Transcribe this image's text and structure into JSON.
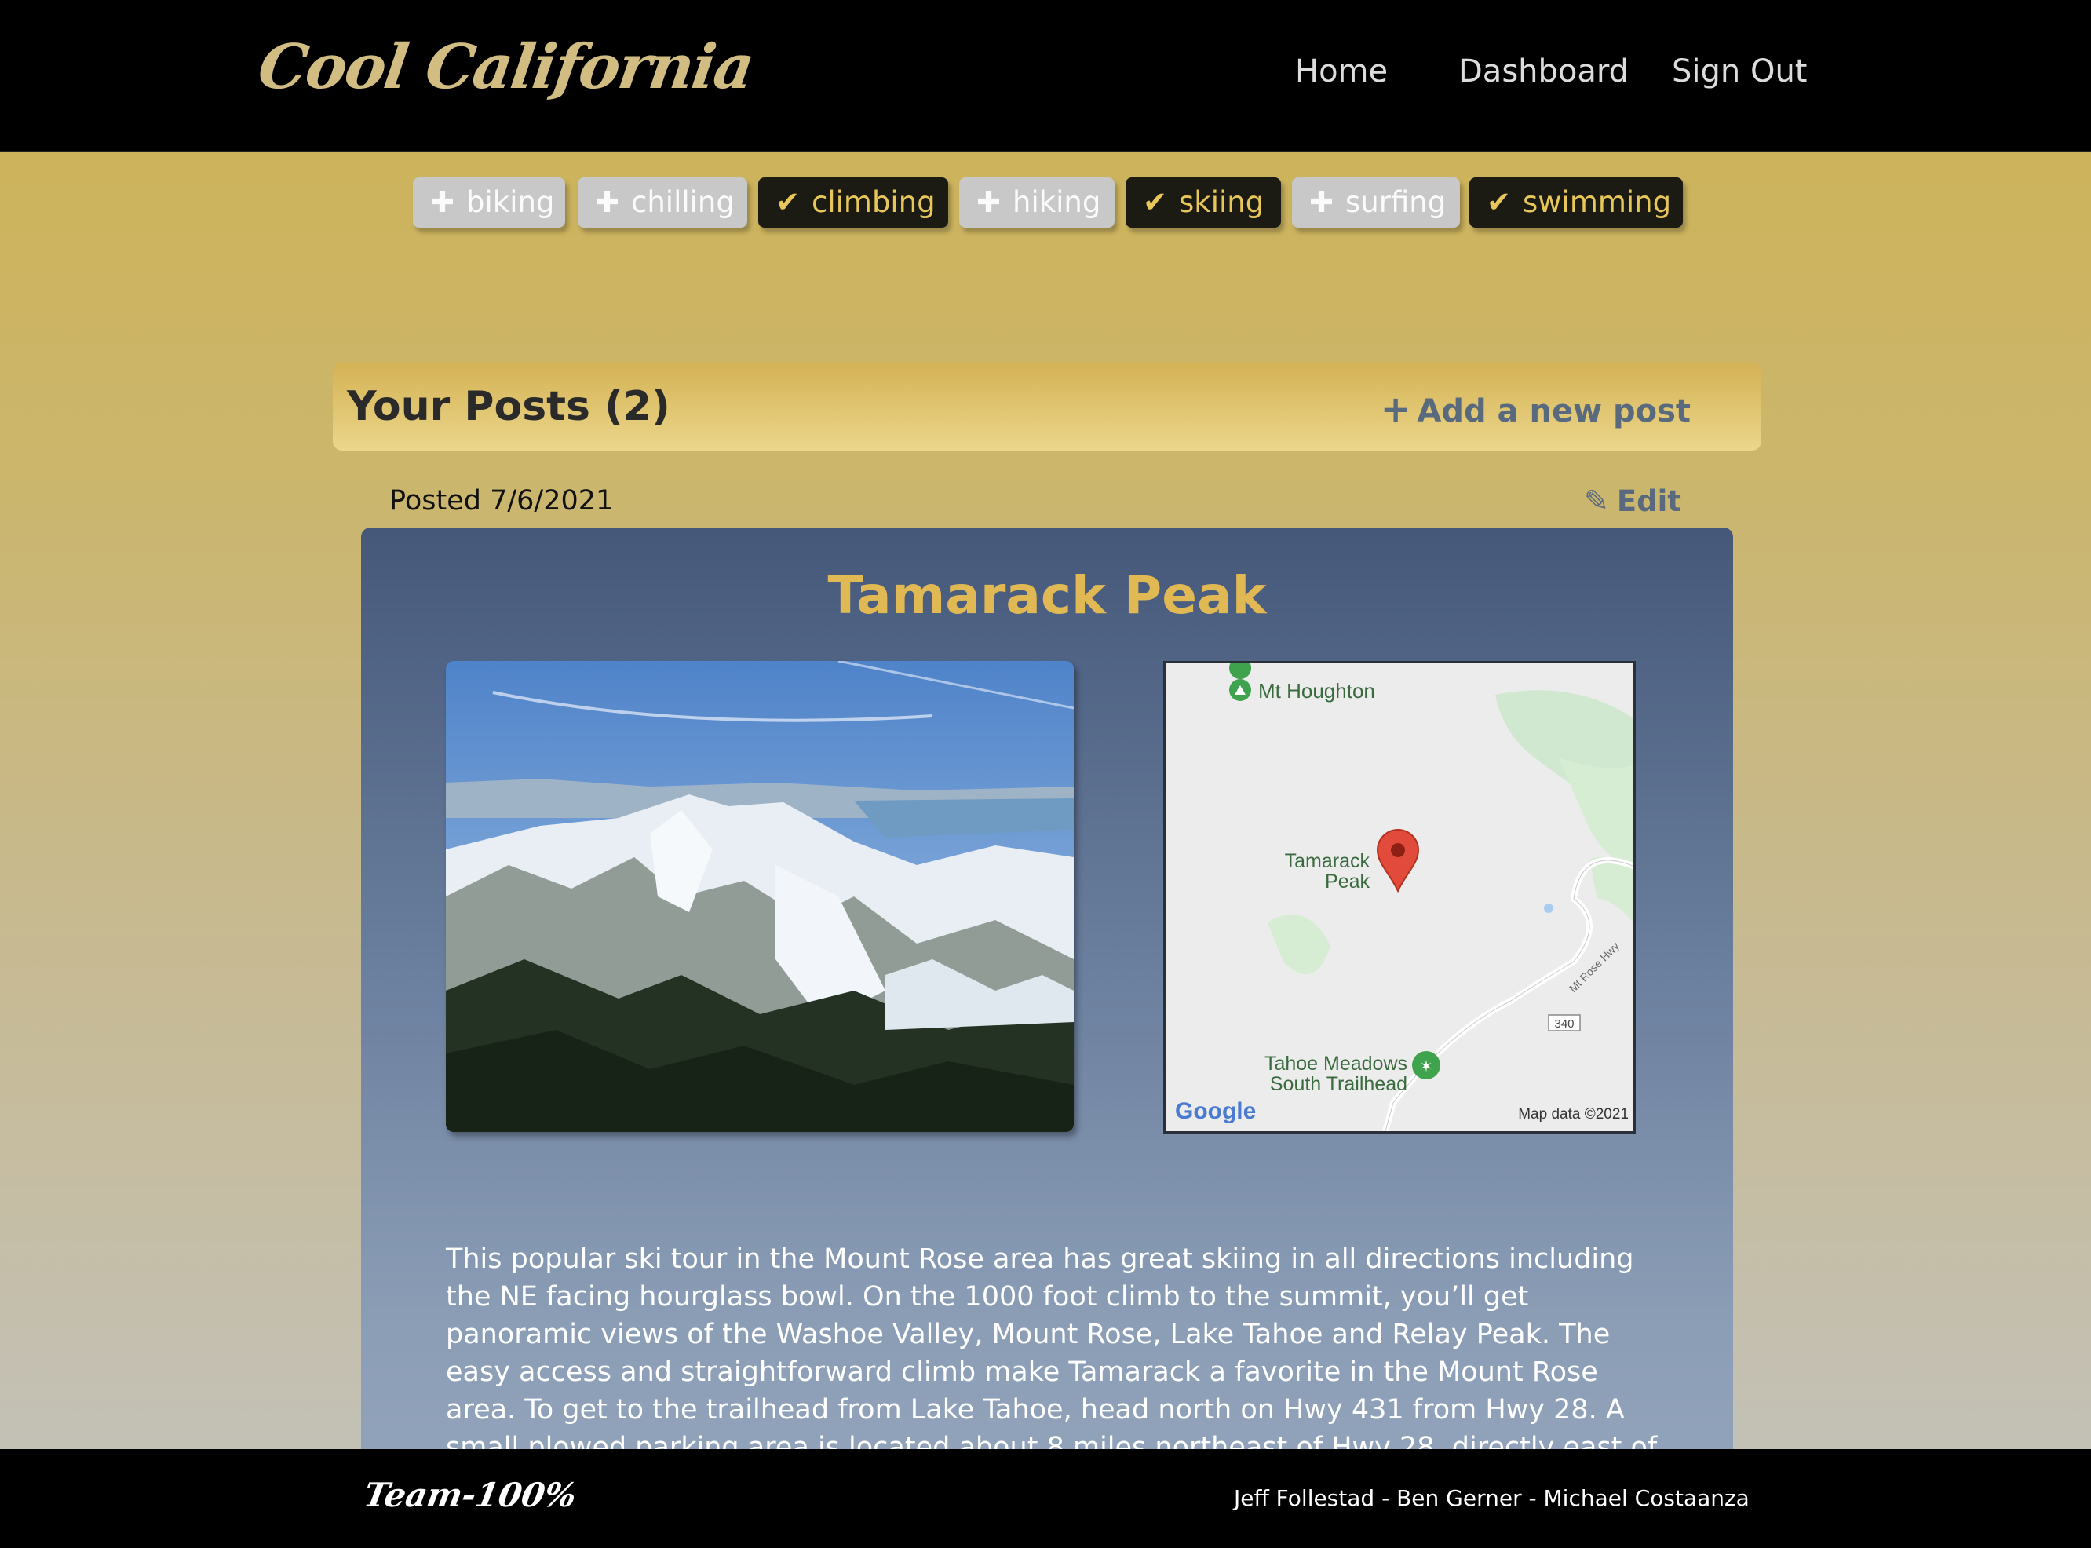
{
  "brand": "Cool California",
  "nav": {
    "home": "Home",
    "dashboard": "Dashboard",
    "sign_out": "Sign Out"
  },
  "filters": [
    {
      "label": "biking",
      "selected": false,
      "icon": "plus-icon"
    },
    {
      "label": "chilling",
      "selected": false,
      "icon": "plus-icon"
    },
    {
      "label": "climbing",
      "selected": true,
      "icon": "check-icon"
    },
    {
      "label": "hiking",
      "selected": false,
      "icon": "plus-icon"
    },
    {
      "label": "skiing",
      "selected": true,
      "icon": "check-icon"
    },
    {
      "label": "surfing",
      "selected": false,
      "icon": "plus-icon"
    },
    {
      "label": "swimming",
      "selected": true,
      "icon": "check-icon"
    }
  ],
  "posts": {
    "title": "Your Posts (2)",
    "add_label": "Add a new post"
  },
  "post": {
    "posted": "Posted 7/6/2021",
    "edit_label": "Edit",
    "title": "Tamarack Peak",
    "map": {
      "labels": {
        "mt_houghton": "Mt Houghton",
        "tamarack_1": "Tamarack",
        "tamarack_2": "Peak",
        "meadows_1": "Tahoe Meadows",
        "meadows_2": "South Trailhead",
        "road": "Mt Rose Hwy",
        "route": "340",
        "logo": "Google",
        "attribution": "Map data ©2021"
      }
    },
    "description": "This popular ski tour in the Mount Rose area has great skiing in all directions including the NE facing hourglass bowl. On the 1000 foot climb to the summit, you’ll get panoramic views of the Washoe Valley, Mount Rose, Lake Tahoe and Relay Peak. The easy access and straightforward climb make Tamarack a favorite in the Mount Rose area. To get to the trailhead from Lake Tahoe, head north on Hwy 431 from Hwy 28. A small plowed parking area is located about 8 miles northeast of Hwy 28, directly east of Tamarack Peak and close to"
  },
  "footer": {
    "team": "Team-100%",
    "credits": "Jeff Follestad - Ben Gerner - Michael Costaanza"
  },
  "colors": {
    "header_bg": "#000000",
    "chip_selected_bg": "#1b1a13",
    "chip_selected_text": "#e8c75a",
    "chip_unselected_bg": "#c8c8c8",
    "accent_title": "#e1b954",
    "link": "#5a6a7e"
  }
}
